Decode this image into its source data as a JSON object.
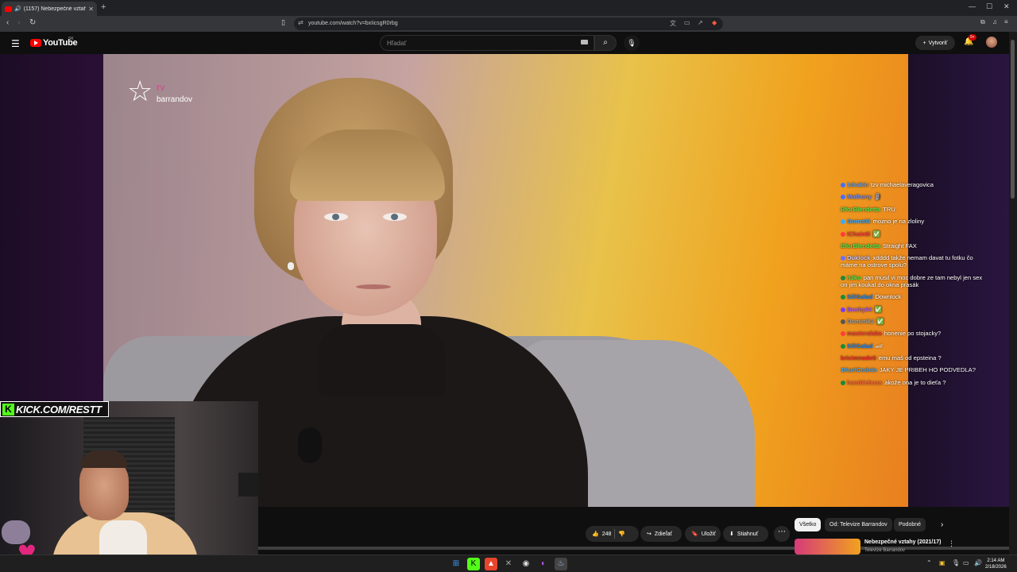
{
  "browser": {
    "tab_title": "(1157) Nebezpečné vztahy (2",
    "url": "youtube.com/watch?v=bxIicsgR0rbg"
  },
  "header": {
    "logo_text": "YouTube",
    "logo_region": "SK",
    "search_placeholder": "Hľadať",
    "create_label": "Vytvoriť",
    "notifications_badge": "9+"
  },
  "video": {
    "channel_logo_tv": "TV",
    "channel_logo_name": "barrandov"
  },
  "chat": [
    {
      "user": "1drakin",
      "text": "tzv michaelaveragovica",
      "color": "#5ea2ff",
      "dot": "#4a6cff"
    },
    {
      "user": "Mathony",
      "text": "🗿",
      "color": "#6f8cff",
      "dot": "#4a6cff"
    },
    {
      "user": "BforBlendetta",
      "text": "TRU",
      "color": "#54e84a",
      "dot": ""
    },
    {
      "user": "Gorro06",
      "text": "mozno je na zloliny",
      "color": "#3aa9ff",
      "dot": "#3aa9ff"
    },
    {
      "user": "IChain8i",
      "text": "✅",
      "color": "#ff3b3b",
      "dot": "#ff3b3b"
    },
    {
      "user": "BforBlendetta",
      "text": "Straight FAX",
      "color": "#54e84a",
      "dot": ""
    },
    {
      "user": "Duklock",
      "text": "xdddd takže nemam davat tu fotku čo máme na ostrove spolu?",
      "color": "#c7c7ff",
      "dot": "#6f6fff"
    },
    {
      "user": "h3ko",
      "text": "pan musil vi moc dobre ze tam nebyl jen sex on jim koukal do okna prasák",
      "color": "#54e84a",
      "dot": "#1a8a3a"
    },
    {
      "user": "SillGalad",
      "text": "Downlock",
      "color": "#1a8aff",
      "dot": "#1a8a3a"
    },
    {
      "user": "Bushy64",
      "text": "✅",
      "color": "#b15aff",
      "dot": "#7a3aff"
    },
    {
      "user": "Dominik2",
      "text": "✅",
      "color": "#a0a0a0",
      "dot": "#555"
    },
    {
      "user": "masteralaka",
      "text": "honenie po stojacky?",
      "color": "#ff3b3b",
      "dot": "#ff3b3b"
    },
    {
      "user": "SillGalad",
      "text": "🏎",
      "color": "#1a8aff",
      "dot": "#1a8a3a"
    },
    {
      "user": "kricimnadeti",
      "text": "emu maš od epsteina ?",
      "color": "#ff2a2a",
      "dot": ""
    },
    {
      "user": "1KurtCodein",
      "text": "JAKY JE PRIBEH HO PODVEDLA?",
      "color": "#3aa9ff",
      "dot": ""
    },
    {
      "user": "hamblebuss",
      "text": "akože ona je to dieťa ?",
      "color": "#ff6b3b",
      "dot": "#1a8a3a"
    }
  ],
  "webcam": {
    "kick_url": "KICK.COM/RESTT"
  },
  "actions": {
    "like_count": "248",
    "share_label": "Zdieľať",
    "save_label": "Uložiť",
    "download_label": "Stiahnuť",
    "more_label": "⋯"
  },
  "chips": [
    "Všetko",
    "Od: Televize Barrandov",
    "Podobné"
  ],
  "recommendation": {
    "title": "Nebezpečné vztahy (2021/17)",
    "channel": "Televize Barrandov"
  },
  "taskbar": {
    "time": "2:14 AM",
    "date": "2/18/2026"
  }
}
